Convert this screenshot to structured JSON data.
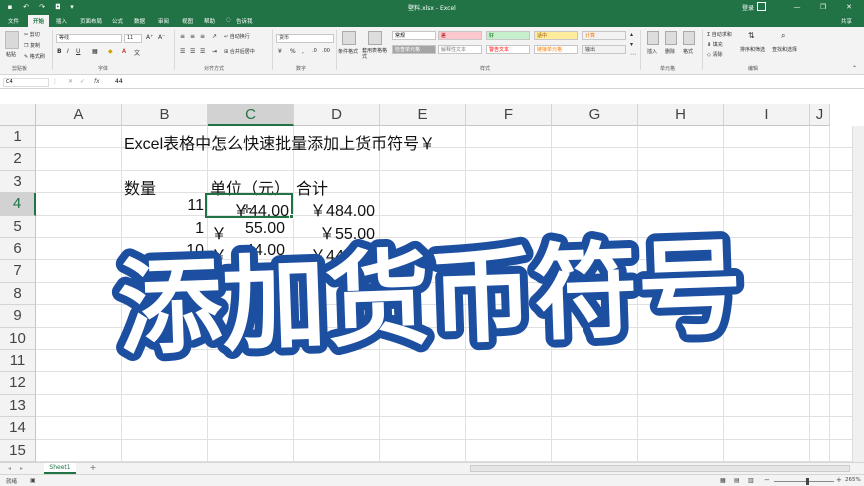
{
  "window": {
    "title": "壁料.xlsx - Excel",
    "signin": "登录",
    "controls": [
      "—",
      "❐",
      "✕"
    ]
  },
  "ribbon_tabs": {
    "items": [
      "文件",
      "开始",
      "插入",
      "页面布局",
      "公式",
      "数据",
      "审阅",
      "视图",
      "帮助"
    ],
    "active_index": 1,
    "tellme": "告诉我",
    "share": "共享"
  },
  "ribbon": {
    "clipboard": {
      "paste": "粘贴",
      "cut": "剪切",
      "copy": "复制",
      "format_painter": "格式刷",
      "label": "剪贴板"
    },
    "font": {
      "name": "等线",
      "size": "11",
      "label": "字体"
    },
    "alignment": {
      "wrap": "自动换行",
      "merge": "合并后居中",
      "label": "对齐方式"
    },
    "number": {
      "format": "货币",
      "label": "数字"
    },
    "styles": {
      "conditional": "条件格式",
      "table": "套用表格格式",
      "cells": [
        {
          "text": "常规",
          "bg": "#ffffff",
          "fg": "#000000"
        },
        {
          "text": "差",
          "bg": "#ffc7ce",
          "fg": "#9c0006"
        },
        {
          "text": "好",
          "bg": "#c6efce",
          "fg": "#006100"
        },
        {
          "text": "适中",
          "bg": "#ffeb9c",
          "fg": "#9c5700"
        },
        {
          "text": "计算",
          "bg": "#f2f2f2",
          "fg": "#fa7d00"
        },
        {
          "text": "检查单元格",
          "bg": "#a5a5a5",
          "fg": "#ffffff"
        },
        {
          "text": "解释性文本",
          "bg": "#ffffff",
          "fg": "#7f7f7f"
        },
        {
          "text": "警告文本",
          "bg": "#ffffff",
          "fg": "#ff0000"
        },
        {
          "text": "链接单元格",
          "bg": "#ffffff",
          "fg": "#fa7d00"
        },
        {
          "text": "输出",
          "bg": "#f2f2f2",
          "fg": "#3f3f3f"
        }
      ],
      "label": "样式"
    },
    "cells_group": {
      "insert": "插入",
      "delete": "删除",
      "format": "格式",
      "label": "单元格"
    },
    "editing": {
      "autosum": "自动求和",
      "fill": "填充",
      "clear": "清除",
      "sort": "排序和筛选",
      "find": "查找和选择",
      "label": "编辑"
    }
  },
  "formula_bar": {
    "name_box": "C4",
    "fx": "fx",
    "value": "44"
  },
  "grid": {
    "columns": [
      "A",
      "B",
      "C",
      "D",
      "E",
      "F",
      "G",
      "H",
      "I",
      "J"
    ],
    "rows": [
      "1",
      "2",
      "3",
      "4",
      "5",
      "6",
      "7",
      "8",
      "9",
      "10",
      "11",
      "12",
      "13",
      "14",
      "15"
    ],
    "selected_column": "C",
    "selected_row": "4",
    "cells": {
      "B1": "Excel表格中怎么快速批量添加上货币符号￥",
      "B3": "数量",
      "C3": "单位（元）",
      "D3": "合计",
      "B4": "11",
      "C4": "￥44.00",
      "D4": "￥484.00",
      "B5": "1",
      "C5_symbol": "￥",
      "C5_value": "55.00",
      "D5": "￥55.00",
      "B6": "10",
      "C6_symbol": "￥",
      "C6_value": "44.00",
      "D6": "￥440.00"
    }
  },
  "overlay_text": "添加货币符号",
  "sheet_tabs": {
    "items": [
      "Sheet1"
    ],
    "add": "+"
  },
  "statusbar": {
    "ready": "就绪",
    "zoom": "265%"
  }
}
